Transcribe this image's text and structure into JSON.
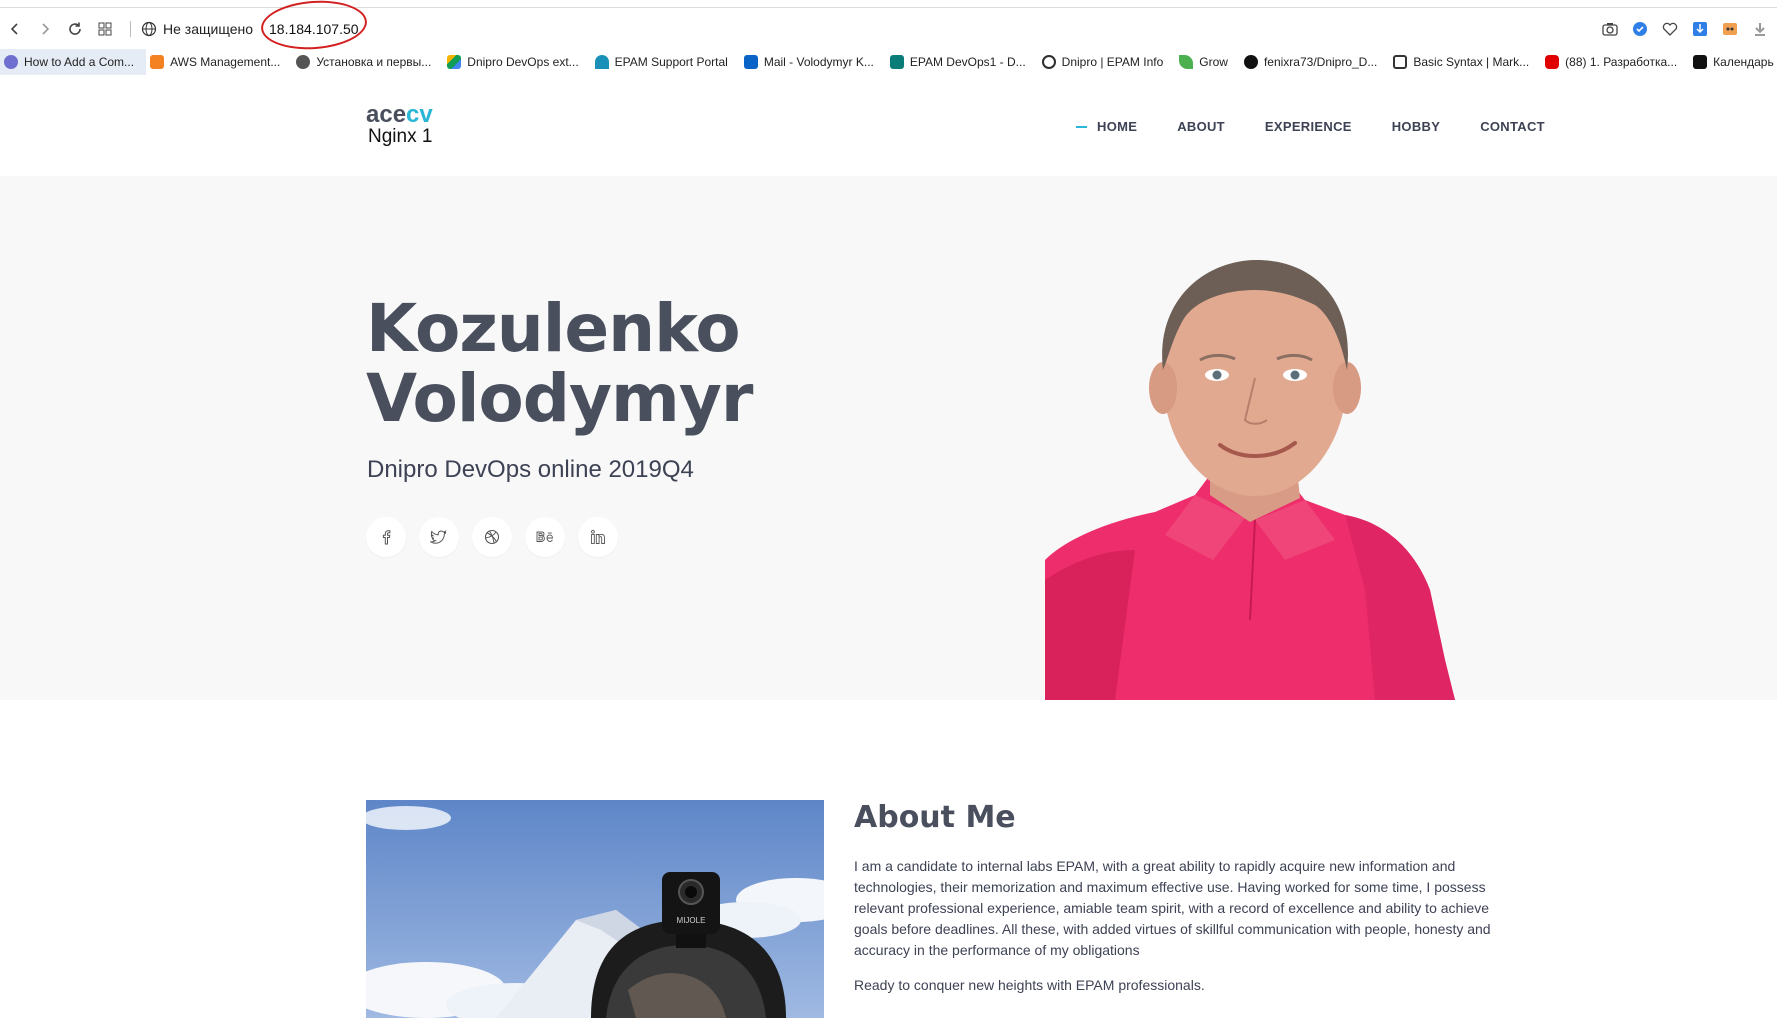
{
  "browser": {
    "security_label": "Не защищено",
    "url": "18.184.107.50",
    "bookmarks": [
      {
        "label": "How to Add a Com...",
        "color": "#6f6fd0"
      },
      {
        "label": "AWS Management...",
        "color": "#f58220"
      },
      {
        "label": "Установка и первы...",
        "color": "#555555"
      },
      {
        "label": "Dnipro DevOps ext...",
        "color": "#2a9d4a"
      },
      {
        "label": "EPAM Support Portal",
        "color": "#1a8fb8"
      },
      {
        "label": "Mail - Volodymyr K...",
        "color": "#0a64c8"
      },
      {
        "label": "EPAM DevOps1 - D...",
        "color": "#0b7d78"
      },
      {
        "label": "Dnipro | EPAM Info",
        "color": "#2e2e2e"
      },
      {
        "label": "Grow",
        "color": "#4caf50"
      },
      {
        "label": "fenixra73/Dnipro_D...",
        "color": "#111111"
      },
      {
        "label": "Basic Syntax | Mark...",
        "color": "#333333"
      },
      {
        "label": "(88) 1. Разработка...",
        "color": "#e00000"
      },
      {
        "label": "Календарь",
        "color": "#111111"
      }
    ]
  },
  "site": {
    "logo_ace": "ace",
    "logo_cv": "cv",
    "logo_sub": "Nginx 1",
    "accent": "#2ab6d6",
    "menu": [
      "HOME",
      "ABOUT",
      "EXPERIENCE",
      "HOBBY",
      "CONTACT"
    ],
    "hero": {
      "name_line1": "Kozulenko",
      "name_line2": "Volodymyr",
      "subtitle": "Dnipro DevOps online 2019Q4"
    },
    "socials": [
      "facebook-icon",
      "twitter-icon",
      "dribbble-icon",
      "behance-icon",
      "linkedin-icon"
    ],
    "about": {
      "title": "About Me",
      "paragraph1": "I am a candidate to internal labs EPAM, with a great ability to rapidly acquire new information and technologies, their memorization and maximum effective use. Having worked for some time, I possess relevant professional experience, amiable team spirit, with a record of excellence and ability to achieve goals before deadlines. All these, with added virtues of skillful communication with people, honesty and accuracy in the performance of my obligations",
      "paragraph2": "Ready to conquer new heights with EPAM professionals.",
      "camera_brand": "MIJOLE"
    }
  }
}
